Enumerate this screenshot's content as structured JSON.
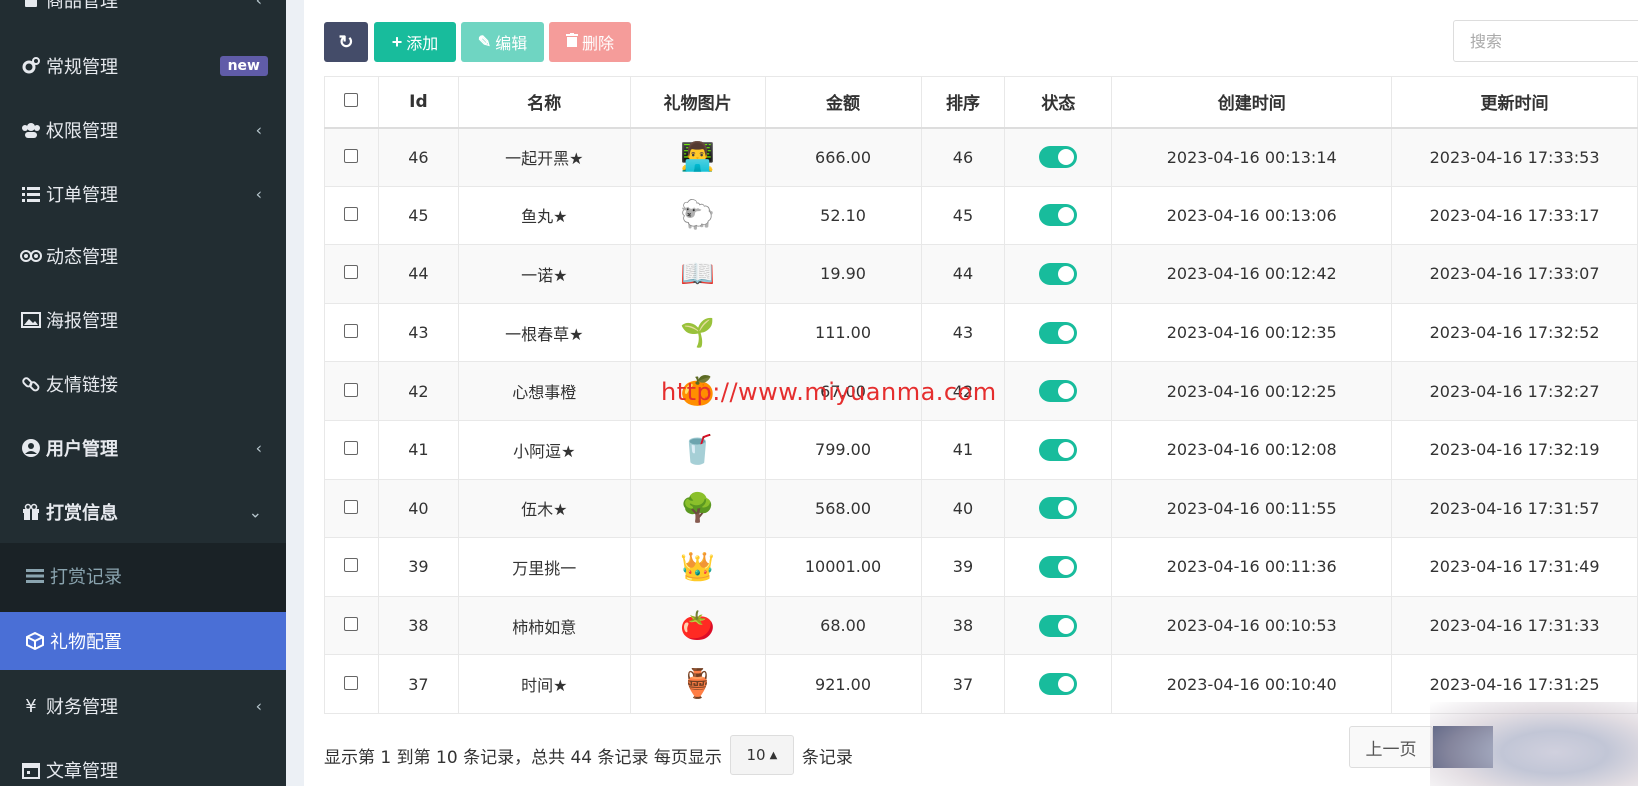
{
  "sidebar": {
    "items": [
      {
        "label": "商品管理",
        "icon": "book-icon",
        "right": "‹"
      },
      {
        "label": "常规管理",
        "icon": "cogs-icon",
        "badge": "new"
      },
      {
        "label": "权限管理",
        "icon": "users-icon",
        "right": "‹"
      },
      {
        "label": "订单管理",
        "icon": "list-icon",
        "right": "‹"
      },
      {
        "label": "动态管理",
        "icon": "tripadvisor-icon"
      },
      {
        "label": "海报管理",
        "icon": "image-icon"
      },
      {
        "label": "友情链接",
        "icon": "link-icon"
      },
      {
        "label": "用户管理",
        "icon": "user-circle-icon",
        "right": "‹"
      },
      {
        "label": "打赏信息",
        "icon": "gift-icon",
        "right": "⌄"
      },
      {
        "label": "打赏记录",
        "icon": "bars-icon"
      },
      {
        "label": "礼物配置",
        "icon": "cube-icon"
      },
      {
        "label": "财务管理",
        "icon": "yen-icon",
        "right": "‹"
      },
      {
        "label": "文章管理",
        "icon": "calendar-icon"
      }
    ]
  },
  "toolbar": {
    "refresh_icon": "↻",
    "add_label": "添加",
    "edit_label": "编辑",
    "delete_label": "删除",
    "add_icon": "+",
    "edit_icon": "✎",
    "delete_icon": "🗑"
  },
  "search": {
    "placeholder": "搜索"
  },
  "table": {
    "headers": [
      "Id",
      "名称",
      "礼物图片",
      "金额",
      "排序",
      "状态",
      "创建时间",
      "更新时间"
    ],
    "rows": [
      {
        "id": "46",
        "name": "一起开黑★",
        "img": "👨‍💻",
        "amount": "666.00",
        "sort": "46",
        "created": "2023-04-16 00:13:14",
        "updated": "2023-04-16 17:33:53"
      },
      {
        "id": "45",
        "name": "鱼丸★",
        "img": "🐑",
        "amount": "52.10",
        "sort": "45",
        "created": "2023-04-16 00:13:06",
        "updated": "2023-04-16 17:33:17"
      },
      {
        "id": "44",
        "name": "一诺★",
        "img": "📖",
        "amount": "19.90",
        "sort": "44",
        "created": "2023-04-16 00:12:42",
        "updated": "2023-04-16 17:33:07"
      },
      {
        "id": "43",
        "name": "一根春草★",
        "img": "🌱",
        "amount": "111.00",
        "sort": "43",
        "created": "2023-04-16 00:12:35",
        "updated": "2023-04-16 17:32:52"
      },
      {
        "id": "42",
        "name": "心想事橙",
        "img": "🍊",
        "amount": "67.00",
        "sort": "42",
        "created": "2023-04-16 00:12:25",
        "updated": "2023-04-16 17:32:27"
      },
      {
        "id": "41",
        "name": "小阿逗★",
        "img": "🥤",
        "amount": "799.00",
        "sort": "41",
        "created": "2023-04-16 00:12:08",
        "updated": "2023-04-16 17:32:19"
      },
      {
        "id": "40",
        "name": "伍木★",
        "img": "🌳",
        "amount": "568.00",
        "sort": "40",
        "created": "2023-04-16 00:11:55",
        "updated": "2023-04-16 17:31:57"
      },
      {
        "id": "39",
        "name": "万里挑一",
        "img": "👑",
        "amount": "10001.00",
        "sort": "39",
        "created": "2023-04-16 00:11:36",
        "updated": "2023-04-16 17:31:49"
      },
      {
        "id": "38",
        "name": "柿柿如意",
        "img": "🍅",
        "amount": "68.00",
        "sort": "38",
        "created": "2023-04-16 00:10:53",
        "updated": "2023-04-16 17:31:33"
      },
      {
        "id": "37",
        "name": "时间★",
        "img": "🏺",
        "amount": "921.00",
        "sort": "37",
        "created": "2023-04-16 00:10:40",
        "updated": "2023-04-16 17:31:25"
      }
    ]
  },
  "pager": {
    "info": "显示第 1 到第 10 条记录，总共 44 条记录 每页显示",
    "page_size": "10",
    "suffix": "条记录",
    "prev": "上一页"
  },
  "watermark": "http://www.miyuanma.com",
  "colors": {
    "sidebar": "#222d32",
    "active": "#4a6fd6",
    "success": "#18bc9c",
    "danger": "#f59c9a"
  }
}
